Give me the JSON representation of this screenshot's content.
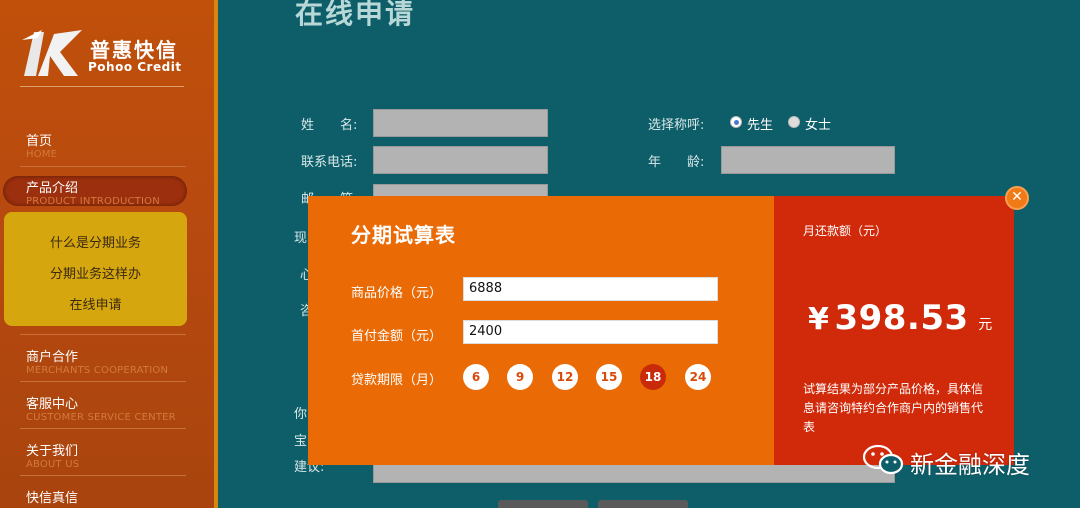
{
  "brand": {
    "name_cn": "普惠快信",
    "name_en": "Pohoo Credit"
  },
  "nav": [
    {
      "cn": "首页",
      "en": "HOME"
    },
    {
      "cn": "产品介绍",
      "en": "PRODUCT INTRODUCTION"
    },
    {
      "cn": "商户合作",
      "en": "MERCHANTS COOPERATION"
    },
    {
      "cn": "客服中心",
      "en": "CUSTOMER SERVICE CENTER"
    },
    {
      "cn": "关于我们",
      "en": "ABOUT US"
    },
    {
      "cn": "快信真信",
      "en": ""
    }
  ],
  "submenu": [
    "什么是分期业务",
    "分期业务这样办",
    "在线申请"
  ],
  "form": {
    "title": "在线申请",
    "name_label": "姓　　名:",
    "phone_label": "联系电话:",
    "email_label": "邮　　箱:",
    "salutation_label": "选择称呼:",
    "salutation_options": [
      "先生",
      "女士"
    ],
    "salutation_selected": "先生",
    "age_label": "年　　龄:",
    "row4_label": "现",
    "row5_label": "心",
    "row6_label": "咨",
    "row7_label": "你",
    "row8_label": "宝",
    "suggest_label": "建议:"
  },
  "calculator": {
    "title": "分期试算表",
    "price_label": "商品价格（元）",
    "price_value": "6888",
    "down_label": "首付金额（元）",
    "down_value": "2400",
    "term_label": "贷款期限（月）",
    "terms": [
      "6",
      "9",
      "12",
      "15",
      "18",
      "24"
    ],
    "selected_term": "18",
    "monthly_label": "月还款额（元）",
    "currency": "¥",
    "monthly_value": "398.53",
    "unit": "元",
    "note": "试算结果为部分产品价格，具体信息请咨询特约合作商户内的销售代表",
    "close": "✕"
  },
  "watermark": {
    "text": "新金融深度"
  },
  "colors": {
    "main_bg": "#0e5e6a",
    "popup_orange": "#ea6b06",
    "popup_red": "#d12a0a",
    "sidebar": "#b84a10",
    "submenu": "#d6a60e"
  }
}
